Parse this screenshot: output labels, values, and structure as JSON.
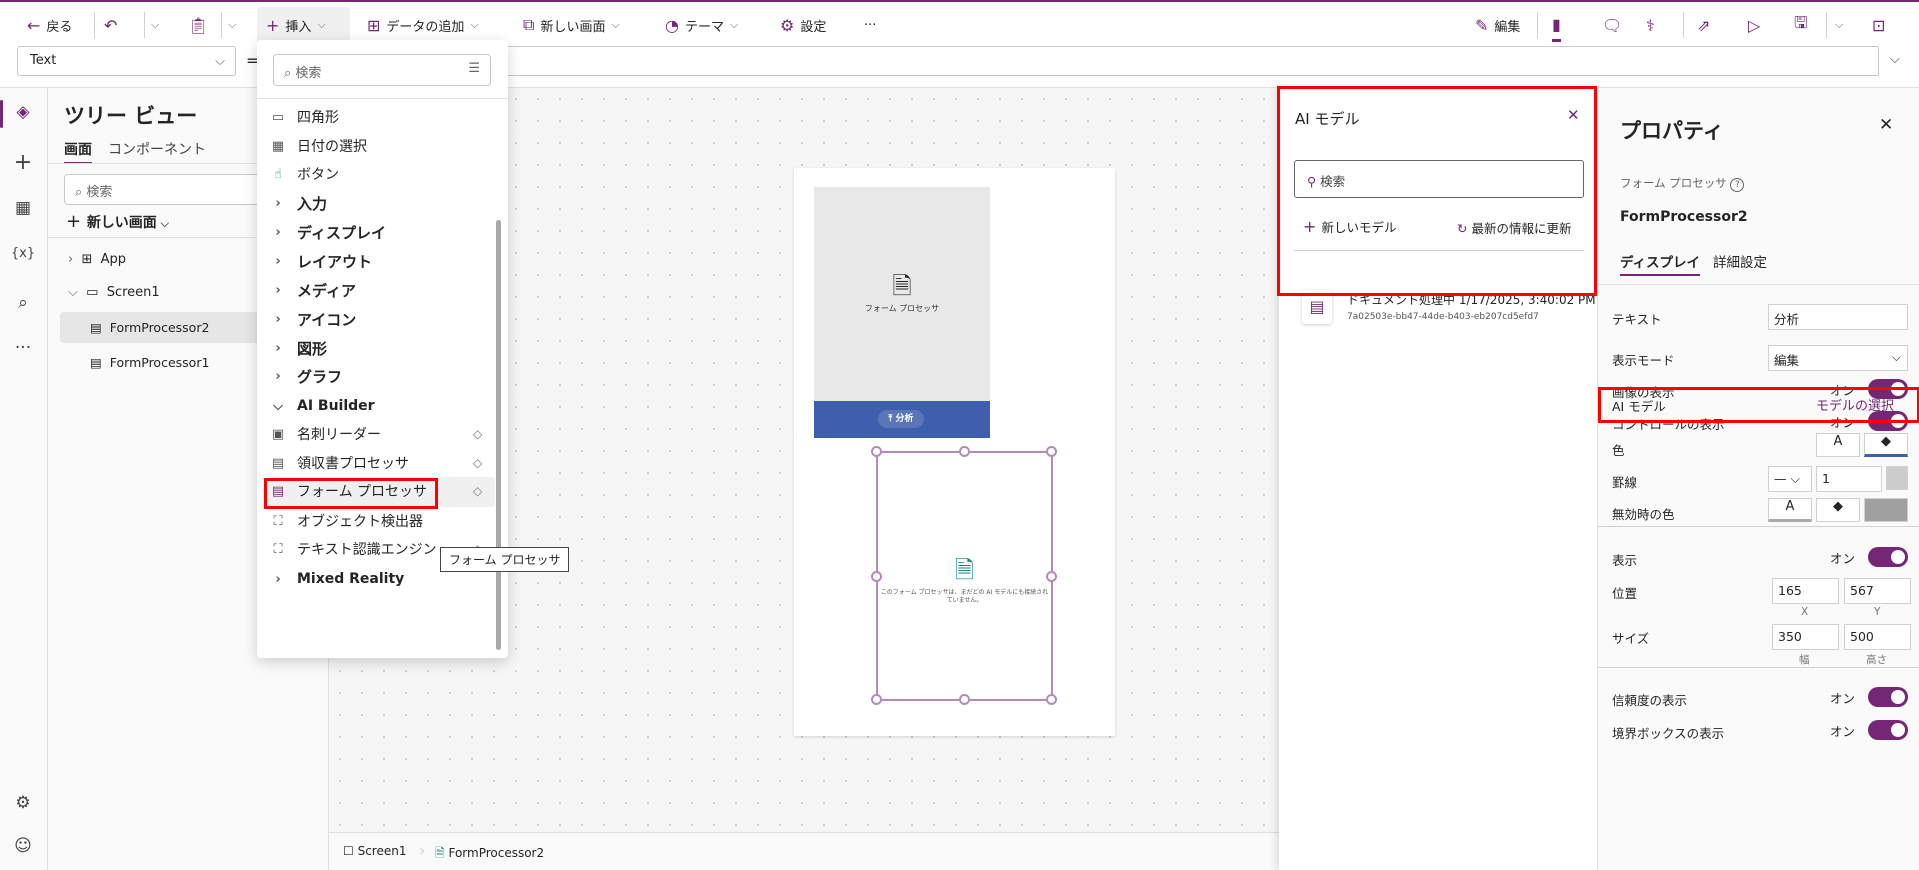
{
  "toolbar": {
    "back": "戻る",
    "insert": "挿入",
    "add_data": "データの追加",
    "new_screen": "新しい画面",
    "theme": "テーマ",
    "settings": "設定",
    "more": "···",
    "edit": "編集"
  },
  "formula": {
    "property": "Text",
    "equals": "="
  },
  "tree": {
    "title": "ツリー ビュー",
    "tabs": [
      "画面",
      "コンポーネント"
    ],
    "search_placeholder": "検索",
    "new_screen": "新しい画面",
    "items": [
      "App",
      "Screen1",
      "FormProcessor2",
      "FormProcessor1"
    ]
  },
  "insert_menu": {
    "search_placeholder": "検索",
    "items": [
      "四角形",
      "日付の選択",
      "ボタン"
    ],
    "categories": [
      "入力",
      "ディスプレイ",
      "レイアウト",
      "メディア",
      "アイコン",
      "図形",
      "グラフ"
    ],
    "ai_builder": "AI Builder",
    "ai_items": [
      "名刺リーダー",
      "領収書プロセッサ",
      "フォーム プロセッサ",
      "オブジェクト検出器",
      "テキスト認識エンジン"
    ],
    "mixed_reality": "Mixed Reality",
    "tooltip": "フォーム プロセッサ"
  },
  "canvas": {
    "fp1_label": "フォーム プロセッサ",
    "fp1_button": "分析",
    "fp2_message": "このフォーム プロセッサは、まだどの AI モデルにも接続されていません。"
  },
  "breadcrumb": [
    "Screen1",
    "FormProcessor2"
  ],
  "ai_panel": {
    "title": "AI モデル",
    "search_placeholder": "検索",
    "new_model": "新しいモデル",
    "refresh": "最新の情報に更新",
    "model": {
      "name": "ドキュメント処理中 1/17/2025, 3:40:02 PM",
      "id": "7a02503e-bb47-44de-b403-eb207cd5efd7"
    }
  },
  "properties": {
    "title": "プロパティ",
    "type": "フォーム プロセッサ",
    "name": "FormProcessor2",
    "tabs": [
      "ディスプレイ",
      "詳細設定"
    ],
    "text_label": "テキスト",
    "text_value": "分析",
    "mode_label": "表示モード",
    "mode_value": "編集",
    "show_image": "画像の表示",
    "show_controls": "コントロールの表示",
    "on": "オン",
    "ai_model_label": "AI モデル",
    "ai_model_link": "モデルの選択",
    "color": "色",
    "border": "罫線",
    "border_width": "1",
    "disabled_color": "無効時の色",
    "visible": "表示",
    "position": "位置",
    "x": "165",
    "y": "567",
    "x_label": "X",
    "y_label": "Y",
    "size": "サイズ",
    "width": "350",
    "height": "500",
    "width_label": "幅",
    "height_label": "高さ",
    "show_confidence": "信頼度の表示",
    "show_bbox": "境界ボックスの表示",
    "font_glyph": "A"
  },
  "colors": {
    "accent": "#742774",
    "button_blue": "#3e5fad",
    "highlight": "#ff0000"
  }
}
